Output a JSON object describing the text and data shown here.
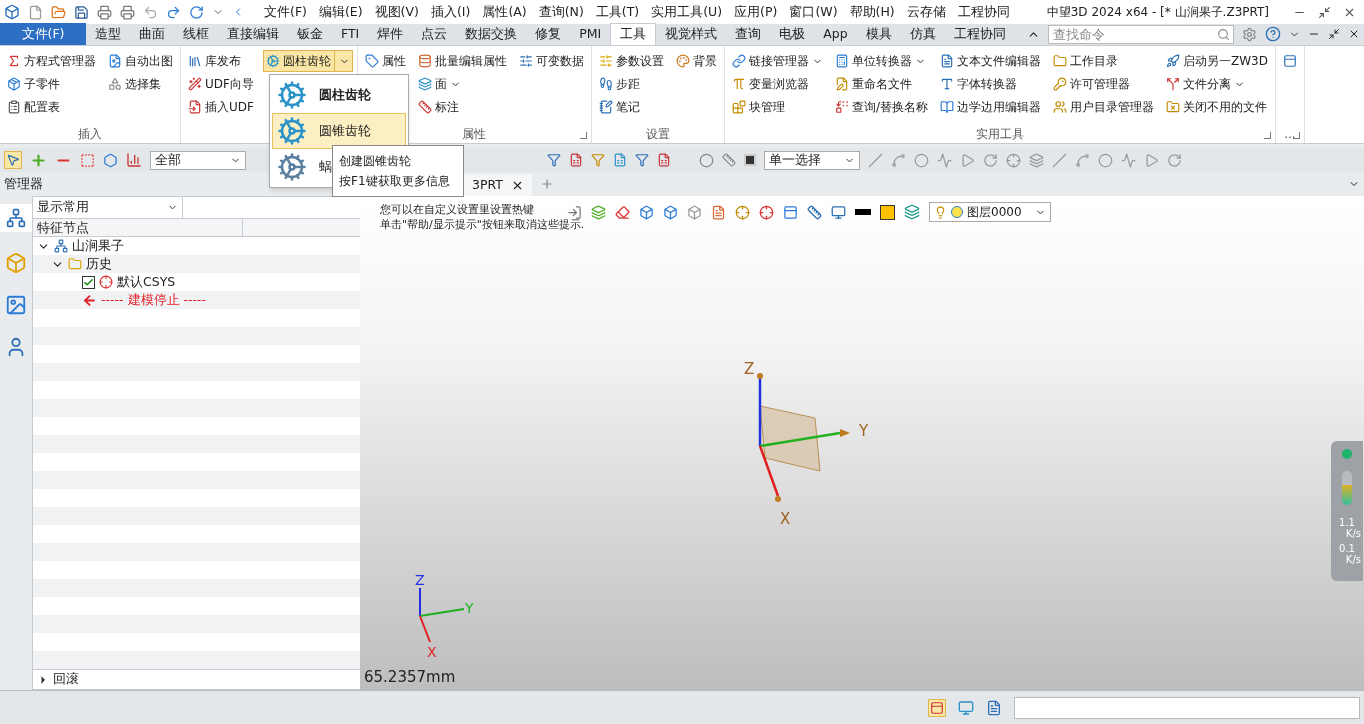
{
  "window": {
    "title": "中望3D 2024 x64 - [* 山涧果子.Z3PRT]"
  },
  "menu_bar": [
    "文件(F)",
    "编辑(E)",
    "视图(V)",
    "插入(I)",
    "属性(A)",
    "查询(N)",
    "工具(T)",
    "实用工具(U)",
    "应用(P)",
    "窗口(W)",
    "帮助(H)",
    "云存储",
    "工程协同"
  ],
  "ribbon_tabs": [
    {
      "label": "文件(F)",
      "kind": "file",
      "selected": false
    },
    {
      "label": "造型",
      "kind": "tab",
      "selected": false
    },
    {
      "label": "曲面",
      "kind": "tab",
      "selected": false
    },
    {
      "label": "线框",
      "kind": "tab",
      "selected": false
    },
    {
      "label": "直接编辑",
      "kind": "tab",
      "selected": false
    },
    {
      "label": "钣金",
      "kind": "tab",
      "selected": false
    },
    {
      "label": "FTI",
      "kind": "tab",
      "selected": false
    },
    {
      "label": "焊件",
      "kind": "tab",
      "selected": false
    },
    {
      "label": "点云",
      "kind": "tab",
      "selected": false
    },
    {
      "label": "数据交换",
      "kind": "tab",
      "selected": false
    },
    {
      "label": "修复",
      "kind": "tab",
      "selected": false
    },
    {
      "label": "PMI",
      "kind": "tab",
      "selected": false
    },
    {
      "label": "工具",
      "kind": "tab",
      "selected": true
    },
    {
      "label": "视觉样式",
      "kind": "tab",
      "selected": false
    },
    {
      "label": "查询",
      "kind": "tab",
      "selected": false
    },
    {
      "label": "电极",
      "kind": "tab",
      "selected": false
    },
    {
      "label": "App",
      "kind": "tab",
      "selected": false
    },
    {
      "label": "模具",
      "kind": "tab",
      "selected": false
    },
    {
      "label": "仿真",
      "kind": "tab",
      "selected": false
    },
    {
      "label": "工程协同",
      "kind": "tab",
      "selected": false
    }
  ],
  "command_search": {
    "placeholder": "查找命令"
  },
  "ribbon_groups": [
    {
      "label": "插入",
      "columns": [
        [
          {
            "label": "方程式管理器",
            "dropdown": false,
            "active": false
          },
          {
            "label": "子零件",
            "dropdown": false,
            "active": false
          },
          {
            "label": "配置表",
            "dropdown": false,
            "active": false
          }
        ],
        [
          {
            "label": "自动出图",
            "dropdown": false,
            "active": false
          },
          {
            "label": "选择集",
            "dropdown": false,
            "active": false
          }
        ]
      ]
    },
    {
      "columns": [
        [
          {
            "label": "库发布",
            "dropdown": false,
            "active": false
          },
          {
            "label": "UDF向导",
            "dropdown": false,
            "active": false
          },
          {
            "label": "插入UDF",
            "dropdown": false,
            "active": false
          }
        ],
        [
          {
            "label": "圆柱齿轮",
            "dropdown": true,
            "active": true
          }
        ]
      ]
    },
    {
      "label": "属性",
      "launcher": true,
      "columns": [
        [
          {
            "label": "属性",
            "dropdown": false,
            "active": false
          }
        ],
        [
          {
            "label": "批量编辑属性",
            "dropdown": false,
            "active": false
          },
          {
            "label": "面",
            "dropdown": true,
            "active": false
          },
          {
            "label": "标注",
            "dropdown": false,
            "active": false
          }
        ],
        [
          {
            "label": "可变数据",
            "dropdown": false,
            "active": false
          }
        ]
      ]
    },
    {
      "label": "设置",
      "columns": [
        [
          {
            "label": "参数设置",
            "dropdown": false,
            "active": false
          },
          {
            "label": "步距",
            "dropdown": false,
            "active": false
          },
          {
            "label": "笔记",
            "dropdown": false,
            "active": false
          }
        ],
        [
          {
            "label": "背景",
            "dropdown": false,
            "active": false
          }
        ]
      ]
    },
    {
      "label": "实用工具",
      "launcher": true,
      "columns": [
        [
          {
            "label": "链接管理器",
            "dropdown": true,
            "active": false
          },
          {
            "label": "变量浏览器",
            "dropdown": false,
            "active": false
          },
          {
            "label": "块管理",
            "dropdown": false,
            "active": false
          }
        ],
        [
          {
            "label": "单位转换器",
            "dropdown": true,
            "active": false
          },
          {
            "label": "重命名文件",
            "dropdown": false,
            "active": false
          },
          {
            "label": "查询/替换名称",
            "dropdown": false,
            "active": false
          }
        ],
        [
          {
            "label": "文本文件编辑器",
            "dropdown": false,
            "active": false
          },
          {
            "label": "字体转换器",
            "dropdown": false,
            "active": false
          },
          {
            "label": "边学边用编辑器",
            "dropdown": false,
            "active": false
          }
        ],
        [
          {
            "label": "工作目录",
            "dropdown": false,
            "active": false
          },
          {
            "label": "许可管理器",
            "dropdown": false,
            "active": false
          },
          {
            "label": "用户目录管理器",
            "dropdown": false,
            "active": false
          }
        ],
        [
          {
            "label": "启动另一ZW3D",
            "dropdown": false,
            "active": false
          },
          {
            "label": "文件分离",
            "dropdown": true,
            "active": false
          },
          {
            "label": "关闭不用的文件",
            "dropdown": false,
            "active": false
          }
        ]
      ]
    },
    {
      "label": "...",
      "launcher": true,
      "columns": [
        [
          {
            "dropdown": false,
            "active": false
          }
        ]
      ]
    }
  ],
  "gear_menu": [
    {
      "label": "圆柱齿轮",
      "kind": "header",
      "selected": false
    },
    {
      "label": "圆锥齿轮",
      "kind": "item",
      "selected": true
    },
    {
      "label": "蜗",
      "kind": "item",
      "selected": false
    }
  ],
  "tooltip": [
    "创建圆锥齿轮",
    "按F1键获取更多信息"
  ],
  "toolbar": {
    "filter": "全部",
    "selection_mode": "单一选择"
  },
  "manager": {
    "title": "管理器",
    "display_filter": "显示常用",
    "column_1": "特征节点",
    "tree": [
      {
        "label": "山涧果子",
        "kind": "part",
        "expanded": true,
        "children": [
          {
            "label": "历史",
            "kind": "folder",
            "expanded": true,
            "children": [
              {
                "label": "默认CSYS",
                "kind": "csys",
                "checked": true
              },
              {
                "label": "----- 建模停止 -----",
                "kind": "stop"
              }
            ]
          }
        ]
      }
    ],
    "footer": {
      "label": "回滚",
      "expanded": false
    }
  },
  "document_tab": {
    "label": "3PRT"
  },
  "viewport": {
    "hints": [
      "您可以在自定义设置里设置热键",
      "单击\"帮助/显示提示\"按钮来取消这些提示."
    ],
    "layer": "图层0000",
    "axes": {
      "z": "Z",
      "y": "Y",
      "x": "X"
    },
    "triad": {
      "z": "Z",
      "y": "Y",
      "x": "X"
    },
    "distance": "65.2357mm"
  },
  "network": {
    "up": "1.1",
    "up_unit": "K/s",
    "down": "0.1",
    "down_unit": "K/s"
  }
}
